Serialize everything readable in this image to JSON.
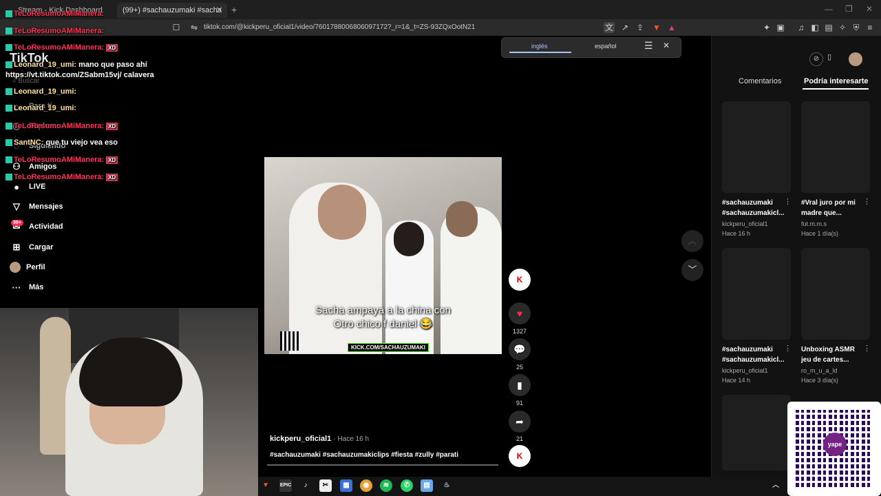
{
  "browser": {
    "tabs": [
      {
        "title": "Stream - Kick Dashboard"
      },
      {
        "title": "(99+) #sachauzumaki #sacha"
      }
    ],
    "new_tab": "+",
    "url": "tiktok.com/@kickperu_oficial1/video/7601788006806097172?_r=1&_t=ZS-93ZQxOotN21"
  },
  "translate": {
    "source_lang": "inglés",
    "target_lang": "español"
  },
  "tiktok": {
    "logo": "TikTok",
    "search_placeholder": "Buscar",
    "nav": [
      {
        "label": "Para ti",
        "icon": "home-icon"
      },
      {
        "label": "Explorar",
        "icon": "compass-icon"
      },
      {
        "label": "Siguiendo",
        "icon": "following-icon"
      },
      {
        "label": "Amigos",
        "icon": "friends-icon"
      },
      {
        "label": "LIVE",
        "icon": "live-icon"
      },
      {
        "label": "Mensajes",
        "icon": "messages-icon"
      },
      {
        "label": "Actividad",
        "icon": "activity-icon",
        "badge": "99+"
      },
      {
        "label": "Cargar",
        "icon": "upload-icon"
      },
      {
        "label": "Perfil",
        "icon": "profile-icon"
      },
      {
        "label": "Más",
        "icon": "more-icon"
      }
    ],
    "video": {
      "caption_line1": "Sacha ampaya a la china con",
      "caption_line2": "Otro chico f daniel 😂",
      "watermark": "KICK.COM/SACHAUZUMAKI",
      "author": "kickperu_oficial1",
      "posted": "Hace 16 h",
      "hashtags": "#sachauzumaki #sachauzumakiclips #fiesta #zully #parati",
      "likes": "1327",
      "comments": "25",
      "saves": "91",
      "shares": "21"
    },
    "right_tabs": {
      "comments": "Comentarios",
      "suggested": "Podría interesarte"
    },
    "suggested": [
      {
        "title_l1": "#sachauzumaki",
        "title_l2": "#sachauzumakicl...",
        "user": "kickperu_oficial1",
        "date": "Hace 16 h"
      },
      {
        "title_l1": "#Vral juro por mi",
        "title_l2": "madre que...",
        "user": "fut.m.m.s",
        "date": "Hace 1 día(s)"
      },
      {
        "title_l1": "#sachauzumaki",
        "title_l2": "#sachauzumakicl...",
        "user": "kickperu_oficial1",
        "date": "Hace 14 h"
      },
      {
        "title_l1": "Unboxing ASMR",
        "title_l2": "jeu de cartes...",
        "user": "ro_m_u_a_ld",
        "date": "Hace 3 día(s)"
      }
    ]
  },
  "chat": [
    {
      "user": "TeLoResumoAMiManera:",
      "text": "",
      "xd": false,
      "cls": "nm"
    },
    {
      "user": "TeLoResumoAMiManera:",
      "text": "",
      "xd": false,
      "cls": "nm"
    },
    {
      "user": "TeLoResumoAMiManera:",
      "text": "",
      "xd": true,
      "cls": "nm"
    },
    {
      "user": "Leonard_19_umi:",
      "text": "mano que paso ahí",
      "xd": false,
      "cls": "nm2"
    },
    {
      "user": "",
      "text": "https://vt.tiktok.com/ZSabm15vj/ calavera",
      "xd": false,
      "cls": "nm2"
    },
    {
      "user": "Leonard_19_umi:",
      "text": "",
      "xd": false,
      "cls": "nm2"
    },
    {
      "user": "Leonard_19_umi:",
      "text": "",
      "xd": false,
      "cls": "nm2"
    },
    {
      "user": "TeLoResumoAMiManera:",
      "text": "",
      "xd": true,
      "cls": "nm"
    },
    {
      "user": "SantNC:",
      "text": "que tu viejo vea eso",
      "xd": false,
      "cls": "nm2"
    },
    {
      "user": "TeLoResumoAMiManera:",
      "text": "",
      "xd": true,
      "cls": "nm"
    },
    {
      "user": "TeLoResumoAMiManera:",
      "text": "",
      "xd": true,
      "cls": "nm"
    }
  ],
  "xd_label": "XD",
  "qr": {
    "brand": "yape"
  }
}
